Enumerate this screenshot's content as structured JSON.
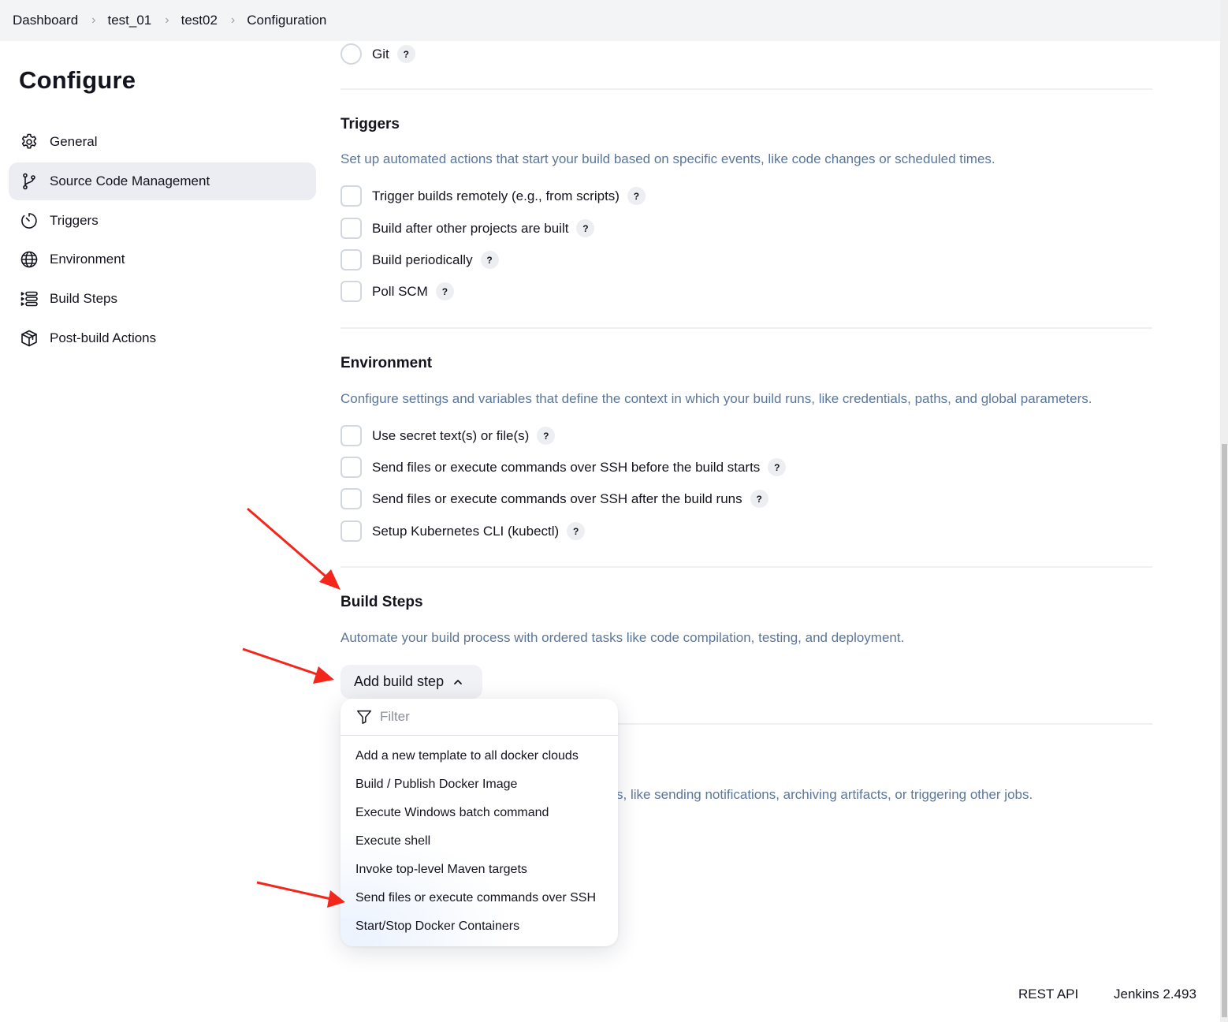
{
  "breadcrumb": {
    "items": [
      "Dashboard",
      "test_01",
      "test02",
      "Configuration"
    ]
  },
  "page": {
    "title": "Configure"
  },
  "sidebar": {
    "items": [
      {
        "label": "General",
        "icon": "gear-icon",
        "active": false
      },
      {
        "label": "Source Code Management",
        "icon": "branch-icon",
        "active": true
      },
      {
        "label": "Triggers",
        "icon": "timer-icon",
        "active": false
      },
      {
        "label": "Environment",
        "icon": "globe-icon",
        "active": false
      },
      {
        "label": "Build Steps",
        "icon": "list-steps-icon",
        "active": false
      },
      {
        "label": "Post-build Actions",
        "icon": "package-icon",
        "active": false
      }
    ]
  },
  "scm": {
    "option_label": "Git",
    "selected": false
  },
  "help_symbol": "?",
  "triggers": {
    "title": "Triggers",
    "description": "Set up automated actions that start your build based on specific events, like code changes or scheduled times.",
    "options": [
      {
        "label": "Trigger builds remotely (e.g., from scripts)",
        "checked": false
      },
      {
        "label": "Build after other projects are built",
        "checked": false
      },
      {
        "label": "Build periodically",
        "checked": false
      },
      {
        "label": "Poll SCM",
        "checked": false
      }
    ]
  },
  "environment": {
    "title": "Environment",
    "description": "Configure settings and variables that define the context in which your build runs, like credentials, paths, and global parameters.",
    "options": [
      {
        "label": "Use secret text(s) or file(s)",
        "checked": false
      },
      {
        "label": "Send files or execute commands over SSH before the build starts",
        "checked": false
      },
      {
        "label": "Send files or execute commands over SSH after the build runs",
        "checked": false
      },
      {
        "label": "Setup Kubernetes CLI (kubectl)",
        "checked": false
      }
    ]
  },
  "build_steps": {
    "title": "Build Steps",
    "description": "Automate your build process with ordered tasks like code compilation, testing, and deployment.",
    "add_button_label": "Add build step",
    "dropdown": {
      "filter_placeholder": "Filter",
      "filter_value": "",
      "items": [
        "Add a new template to all docker clouds",
        "Build / Publish Docker Image",
        "Execute Windows batch command",
        "Execute shell",
        "Invoke top-level Maven targets",
        "Send files or execute commands over SSH",
        "Start/Stop Docker Containers"
      ]
    }
  },
  "post_build": {
    "description_visible_fragment": "s, like sending notifications, archiving artifacts, or triggering other jobs."
  },
  "footer": {
    "rest_api": "REST API",
    "version": "Jenkins 2.493"
  },
  "annotations": {
    "arrow_color": "#f2261b"
  }
}
